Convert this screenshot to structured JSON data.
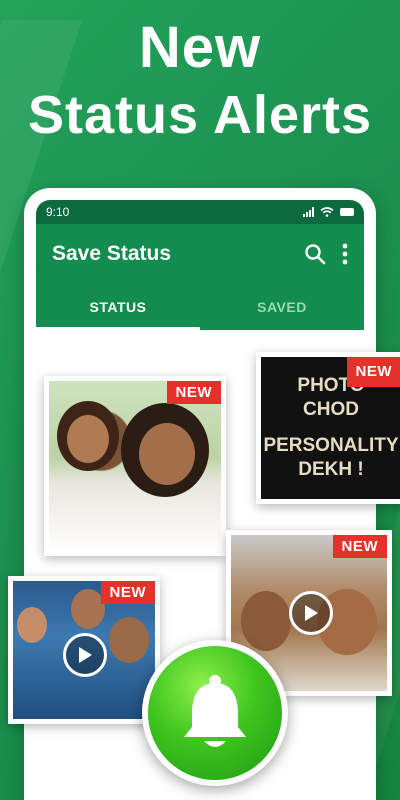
{
  "headline": {
    "line1": "New",
    "line2": "Status Alerts"
  },
  "status_bar": {
    "time": "9:10",
    "icons": [
      "signal-icon",
      "wifi-icon",
      "battery-icon"
    ]
  },
  "app_bar": {
    "title": "Save Status",
    "icons": [
      "search-icon",
      "more-vert-icon"
    ]
  },
  "tabs": [
    {
      "label": "STATUS",
      "active": true
    },
    {
      "label": "SAVED",
      "active": false
    }
  ],
  "cards": [
    {
      "id": "family",
      "badge": "NEW",
      "type": "image"
    },
    {
      "id": "quote",
      "badge": "NEW",
      "type": "image",
      "lines": [
        "PHOTO",
        "CHOD",
        "PERSONALITY",
        "DEKH !"
      ]
    },
    {
      "id": "crowd",
      "badge": "NEW",
      "type": "video"
    },
    {
      "id": "wrestling",
      "badge": "NEW",
      "type": "video"
    }
  ],
  "colors": {
    "background": "#1c9150",
    "app_bar": "#138c50",
    "status_bar": "#0b6b3f",
    "badge": "#e4322b",
    "bell": "#3fc41e"
  },
  "fab": {
    "icon": "bell-icon"
  }
}
